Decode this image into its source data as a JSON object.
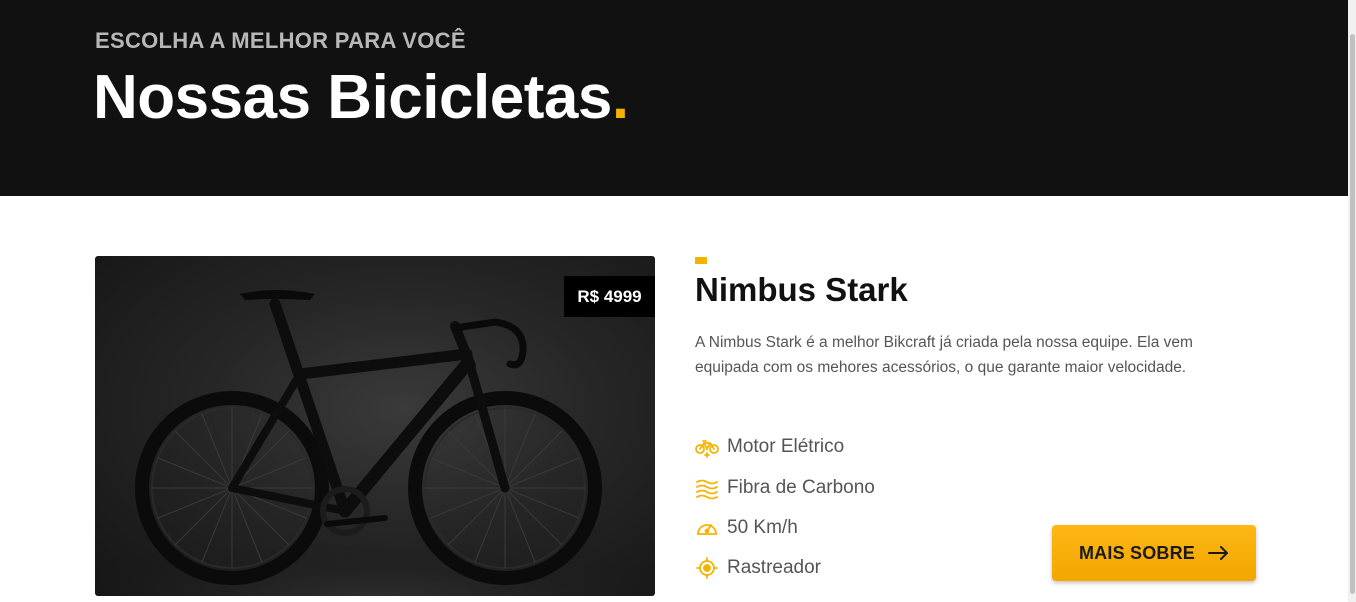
{
  "hero": {
    "eyebrow": "ESCOLHA A MELHOR PARA VOCÊ",
    "title": "Nossas Bicicletas",
    "title_dot": "."
  },
  "product": {
    "image_alt": "bicicleta preta",
    "price": "R$ 4999",
    "name": "Nimbus Stark",
    "description": "A Nimbus Stark é a melhor Bikcraft já criada pela nossa equipe. Ela vem equipada com os mehores acessórios, o que garante maior velocidade.",
    "features": [
      {
        "icon": "electric-bike-icon",
        "label": "Motor Elétrico"
      },
      {
        "icon": "carbon-fiber-icon",
        "label": "Fibra de Carbono"
      },
      {
        "icon": "speedometer-icon",
        "label": "50 Km/h"
      },
      {
        "icon": "tracker-icon",
        "label": "Rastreador"
      }
    ],
    "cta_label": "MAIS SOBRE"
  },
  "colors": {
    "accent": "#f5b301",
    "hero_bg": "#111111",
    "text_dark": "#111111",
    "text_body": "#555555"
  }
}
